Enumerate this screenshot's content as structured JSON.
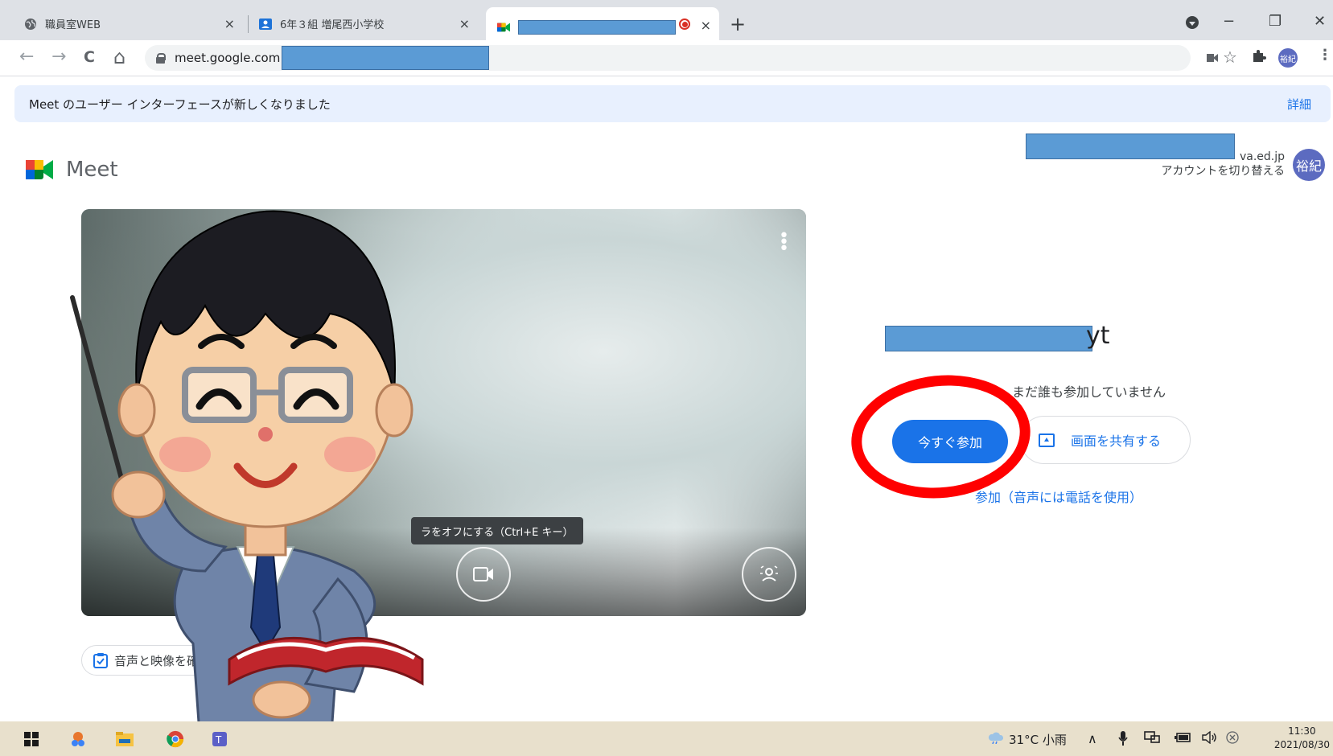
{
  "browser": {
    "tabs": [
      {
        "title": "職員室WEB",
        "close": "×"
      },
      {
        "title": "6年３組 増尾西小学校",
        "close": "×"
      },
      {
        "title": "",
        "close": "×"
      }
    ],
    "new_tab": "+",
    "window_controls": {
      "minimize": "−",
      "restore": "❐",
      "close": "✕"
    },
    "url": "meet.google.com",
    "nav": {
      "back": "←",
      "forward": "→",
      "reload": "C",
      "home": "⌂"
    },
    "toolbar_avatar": "裕紀"
  },
  "banner": {
    "text": "Meet のユーザー インターフェースが新しくなりました",
    "link": "詳細"
  },
  "meet": {
    "brand": "Meet",
    "account_email": "va.ed.jp",
    "switch_account": "アカウントを切り替える",
    "account_avatar": "裕紀",
    "tooltip": "ラをオフにする（Ctrl+E キー）",
    "check_av": "音声と映像を確認",
    "meeting_title_suffix": "yt",
    "status": "まだ誰も参加していません",
    "join_label": "今すぐ参加",
    "share_label": "画面を共有する",
    "phone_label": "参加（音声には電話を使用）"
  },
  "taskbar": {
    "weather": "31°C 小雨",
    "time": "11:30",
    "date": "2021/08/30",
    "tray_caret": "∧"
  },
  "colors": {
    "accent": "#1a73e8",
    "highlight_ring": "#ff0000",
    "redaction": "#5b9bd5"
  }
}
